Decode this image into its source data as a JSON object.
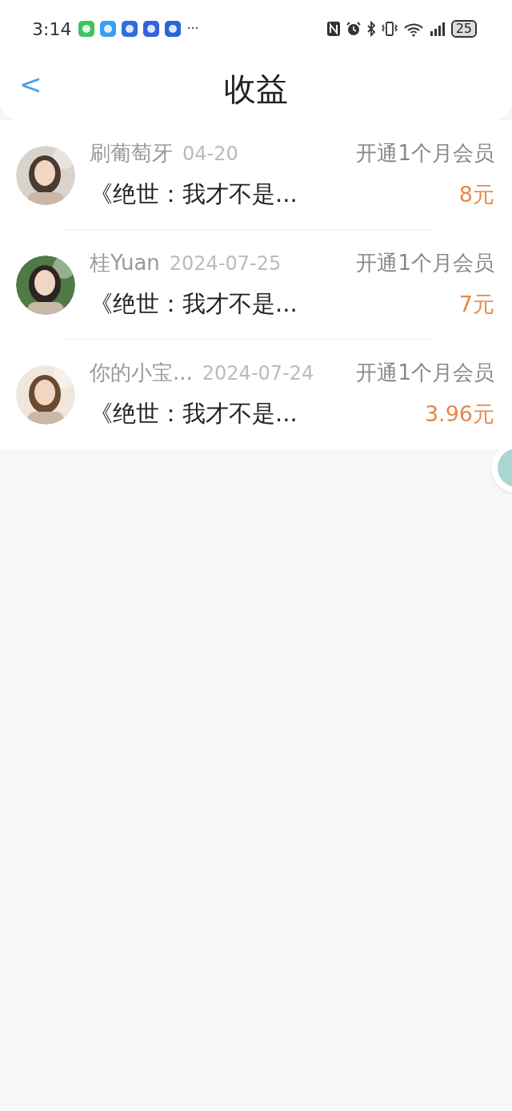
{
  "status_bar": {
    "time": "3:14",
    "more": "···",
    "battery": "25"
  },
  "header": {
    "back": "<",
    "title": "收益"
  },
  "records": [
    {
      "name": "刷葡萄牙",
      "date": "04-20",
      "desc": "开通1个月会员",
      "book": "《绝世：我才不是...",
      "amount": "8元"
    },
    {
      "name": "桂Yuan",
      "date": "2024-07-25",
      "desc": "开通1个月会员",
      "book": "《绝世：我才不是...",
      "amount": "7元"
    },
    {
      "name": "你的小宝...",
      "date": "2024-07-24",
      "desc": "开通1个月会员",
      "book": "《绝世：我才不是...",
      "amount": "3.96元"
    }
  ]
}
